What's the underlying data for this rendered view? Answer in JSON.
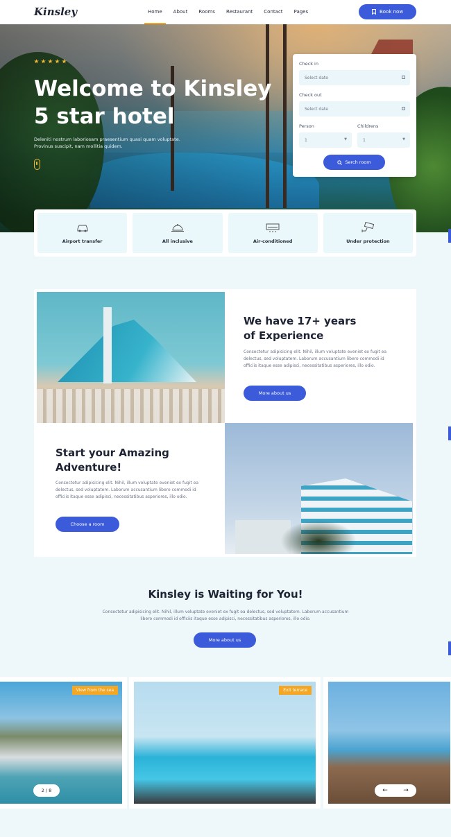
{
  "nav": {
    "logo": "Kinsley",
    "links": [
      "Home",
      "About",
      "Rooms",
      "Restaurant",
      "Contact",
      "Pages"
    ],
    "book_label": "Book now"
  },
  "hero": {
    "rating_stars": 5,
    "title_line1": "Welcome to Kinsley",
    "title_line2": "5 star hotel",
    "description": "Deleniti nostrum laboriosam praesentium quasi quam voluptate. Provinus suscipit, nam mollitia quidem."
  },
  "booking": {
    "checkin_label": "Check in",
    "checkin_placeholder": "Select date",
    "checkout_label": "Check out",
    "checkout_placeholder": "Select date",
    "person_label": "Person",
    "person_value": "1",
    "children_label": "Childrens",
    "children_value": "1",
    "search_label": "Serch room"
  },
  "amenities": [
    {
      "label": "Airport transfer",
      "icon": "car-icon"
    },
    {
      "label": "All inclusive",
      "icon": "cloche-icon"
    },
    {
      "label": "Air-conditioned",
      "icon": "air-conditioner-icon"
    },
    {
      "label": "Under protection",
      "icon": "cctv-camera-icon"
    }
  ],
  "experience": {
    "title_line1": "We have 17+ years",
    "title_line2": "of Experience",
    "text": "Consectetur adipisicing elit. Nihil, illum voluptate eveniet ex fugit ea delectus, sed voluptatem. Laborum accusantium libero commodi id officiis itaque esse adipisci, necessitatibus asperiores, illo odio.",
    "button": "More about us"
  },
  "adventure": {
    "title_line1": "Start your Amazing",
    "title_line2": "Adventure!",
    "text": "Consectetur adipisicing elit. Nihil, illum voluptate eveniet ex fugit ea delectus, sed voluptatem. Laborum accusantium libero commodi id officiis itaque esse adipisci, necessitatibus asperiores, illo odio.",
    "button": "Choose a room"
  },
  "waiting": {
    "title": "Kinsley is Waiting for You!",
    "text": "Consectetur adipisicing elit. Nihil, illum voluptate eveniet ex fugit ea delectus, sed voluptatem. Laborum accusantium libero commodi id officiis itaque esse adipisci, necessitatibus asperiores, illo odio.",
    "button": "More about us"
  },
  "gallery": {
    "items": [
      {
        "tag": "View from the sea"
      },
      {
        "tag": "Exit terrace"
      },
      {
        "tag": ""
      }
    ],
    "counter": "2 / 8",
    "prev": "←",
    "next": "→"
  },
  "colors": {
    "accent": "#3b5bdb",
    "highlight": "#f5a623",
    "background": "#eef8fb"
  }
}
